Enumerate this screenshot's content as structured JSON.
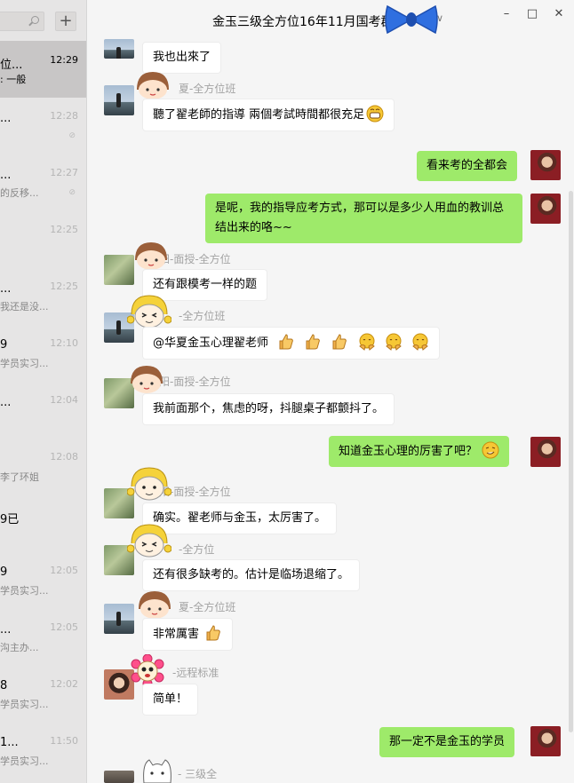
{
  "window": {
    "title": "金玉三级全方位16年11月国考群",
    "colors": {
      "self_bubble": "#9eea6a",
      "other_bubble": "#ffffff",
      "sidebar": "#e6e5e5",
      "background": "#f5f5f5"
    }
  },
  "sidebar": {
    "add_label": "+",
    "chats": [
      {
        "name": "位...",
        "preview": ": 一般",
        "time": "12:29",
        "active": true,
        "muted": false
      },
      {
        "name": "...",
        "preview": "",
        "time": "12:28",
        "active": false,
        "muted": true
      },
      {
        "name": "...",
        "preview": "的反移...",
        "time": "12:27",
        "active": false,
        "muted": true
      },
      {
        "name": "",
        "preview": "",
        "time": "12:25",
        "active": false,
        "muted": false
      },
      {
        "name": "...",
        "preview": "我还是没...",
        "time": "12:25",
        "active": false,
        "muted": false
      },
      {
        "name": "9",
        "preview": "学员实习...",
        "time": "12:10",
        "active": false,
        "muted": false
      },
      {
        "name": "...",
        "preview": "",
        "time": "12:04",
        "active": false,
        "muted": false
      },
      {
        "name": "",
        "preview": "李了环姐",
        "time": "12:08",
        "active": false,
        "muted": false
      },
      {
        "name": "9已",
        "preview": "",
        "time": "",
        "active": false,
        "muted": false
      },
      {
        "name": "9",
        "preview": "学员实习...",
        "time": "12:05",
        "active": false,
        "muted": false
      },
      {
        "name": "...",
        "preview": "沟主办...",
        "time": "12:05",
        "active": false,
        "muted": false
      },
      {
        "name": "8",
        "preview": "学员实习...",
        "time": "12:02",
        "active": false,
        "muted": false
      },
      {
        "name": "1...",
        "preview": "学员实习...",
        "time": "11:50",
        "active": false,
        "muted": false
      }
    ]
  },
  "messages": [
    {
      "side": "in",
      "sender": "",
      "text": "我也出來了",
      "avatar": "sky-avatar"
    },
    {
      "side": "in",
      "sender": "夏-全方位班",
      "text": "聽了翟老師的指導 兩個考試時間都很充足",
      "emoji": [
        "grin"
      ],
      "avatar": "sky-avatar"
    },
    {
      "side": "out",
      "text": "看来考的全都会",
      "avatar": "self-avatar"
    },
    {
      "side": "out",
      "text": "是呢，我的指导应考方式，那可以是多少人用血的教训总结出来的咯~~",
      "avatar": "self-avatar"
    },
    {
      "side": "in",
      "sender": "阳-面授-全方位",
      "text": "还有跟模考一样的题",
      "avatar": "plant-avatar"
    },
    {
      "side": "in",
      "sender": "-全方位班",
      "text": "@华夏金玉心理翟老师",
      "emoji": [
        "thumbs-up",
        "thumbs-up",
        "thumbs-up",
        "hug",
        "hug",
        "hug"
      ],
      "avatar": "sky-avatar"
    },
    {
      "side": "in",
      "sender": "阳-面授-全方位",
      "text": "我前面那个，焦虑的呀，抖腿桌子都颤抖了。",
      "avatar": "plant-avatar"
    },
    {
      "side": "out",
      "text": "知道金玉心理的厉害了吧？",
      "emoji": [
        "smirk"
      ],
      "avatar": "self-avatar"
    },
    {
      "side": "in",
      "sender": "阳-面授-全方位",
      "text": "确实。翟老师与金玉，太厉害了。",
      "avatar": "plant-avatar"
    },
    {
      "side": "in",
      "sender": "-全方位",
      "text": "还有很多缺考的。估计是临场退缩了。",
      "avatar": "plant-avatar"
    },
    {
      "side": "in",
      "sender": "夏-全方位班",
      "text": "非常厲害",
      "emoji": [
        "thumbs-up"
      ],
      "avatar": "sky-avatar"
    },
    {
      "side": "in",
      "sender": "-远程标准",
      "text": "简单！",
      "avatar": "woman-avatar"
    },
    {
      "side": "out",
      "text": "那一定不是金玉的学员",
      "avatar": "self-avatar"
    },
    {
      "side": "in",
      "sender": "- 三级全",
      "text": "",
      "avatar": "cat-avatar"
    }
  ]
}
